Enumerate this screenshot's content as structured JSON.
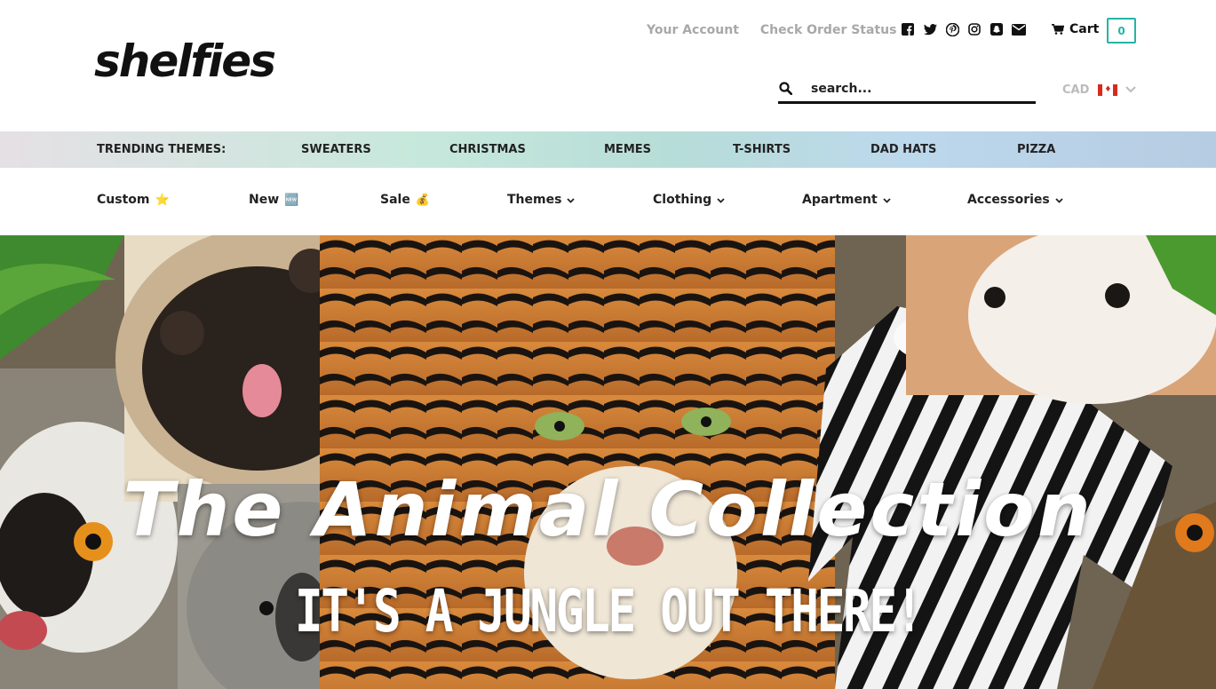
{
  "header": {
    "logo_text": "shelfies",
    "top_links": [
      "Your Account",
      "Check Order Status"
    ],
    "social_icons": [
      "facebook-icon",
      "twitter-icon",
      "pinterest-icon",
      "instagram-icon",
      "snapchat-icon",
      "email-icon"
    ],
    "cart_label": "Cart",
    "cart_count": "0",
    "search_placeholder": "search...",
    "currency": "CAD",
    "currency_flag": "canada-flag-icon"
  },
  "trending": {
    "label": "TRENDING THEMES:",
    "items": [
      "SWEATERS",
      "CHRISTMAS",
      "MEMES",
      "T-SHIRTS",
      "DAD HATS",
      "PIZZA"
    ]
  },
  "nav": {
    "items": [
      {
        "label": "Custom",
        "emoji": "⭐"
      },
      {
        "label": "New",
        "emoji": "🆕"
      },
      {
        "label": "Sale",
        "emoji": "💰"
      },
      {
        "label": "Themes",
        "chevron": true
      },
      {
        "label": "Clothing",
        "chevron": true
      },
      {
        "label": "Apartment",
        "chevron": true
      },
      {
        "label": "Accessories",
        "chevron": true
      }
    ]
  },
  "hero": {
    "title": "The Animal Collection",
    "subtitle": "IT'S A JUNGLE OUT THERE!"
  },
  "colors": {
    "accent": "#25b5a5",
    "muted_link": "#a8a8a8",
    "text": "#222222"
  }
}
